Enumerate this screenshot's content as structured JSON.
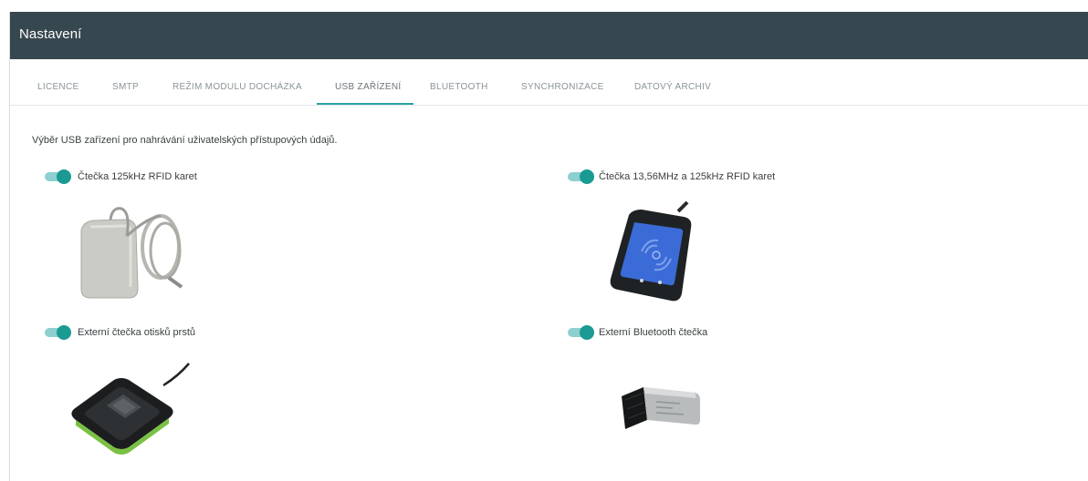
{
  "header": {
    "title": "Nastavení"
  },
  "tabs": [
    {
      "label": "LICENCE"
    },
    {
      "label": "SMTP"
    },
    {
      "label": "REŽIM MODULU DOCHÁZKA"
    },
    {
      "label": "USB ZAŘÍZENÍ"
    },
    {
      "label": "BLUETOOTH"
    },
    {
      "label": "SYNCHRONIZACE"
    },
    {
      "label": "DATOVÝ ARCHIV"
    }
  ],
  "active_tab": "USB ZAŘÍZENÍ",
  "description": "Výběr USB zařízení pro nahrávání uživatelských přístupových údajů.",
  "devices": [
    {
      "label": "Čtečka 125kHz RFID karet",
      "enabled": true
    },
    {
      "label": "Čtečka 13,56MHz a 125kHz RFID karet",
      "enabled": true
    },
    {
      "label": "Externí čtečka otisků prstů",
      "enabled": true
    },
    {
      "label": "Externí Bluetooth čtečka",
      "enabled": true
    }
  ],
  "colors": {
    "header_bg": "#37474f",
    "accent": "#1a9a92",
    "toggle_track": "#8ecfd0"
  }
}
